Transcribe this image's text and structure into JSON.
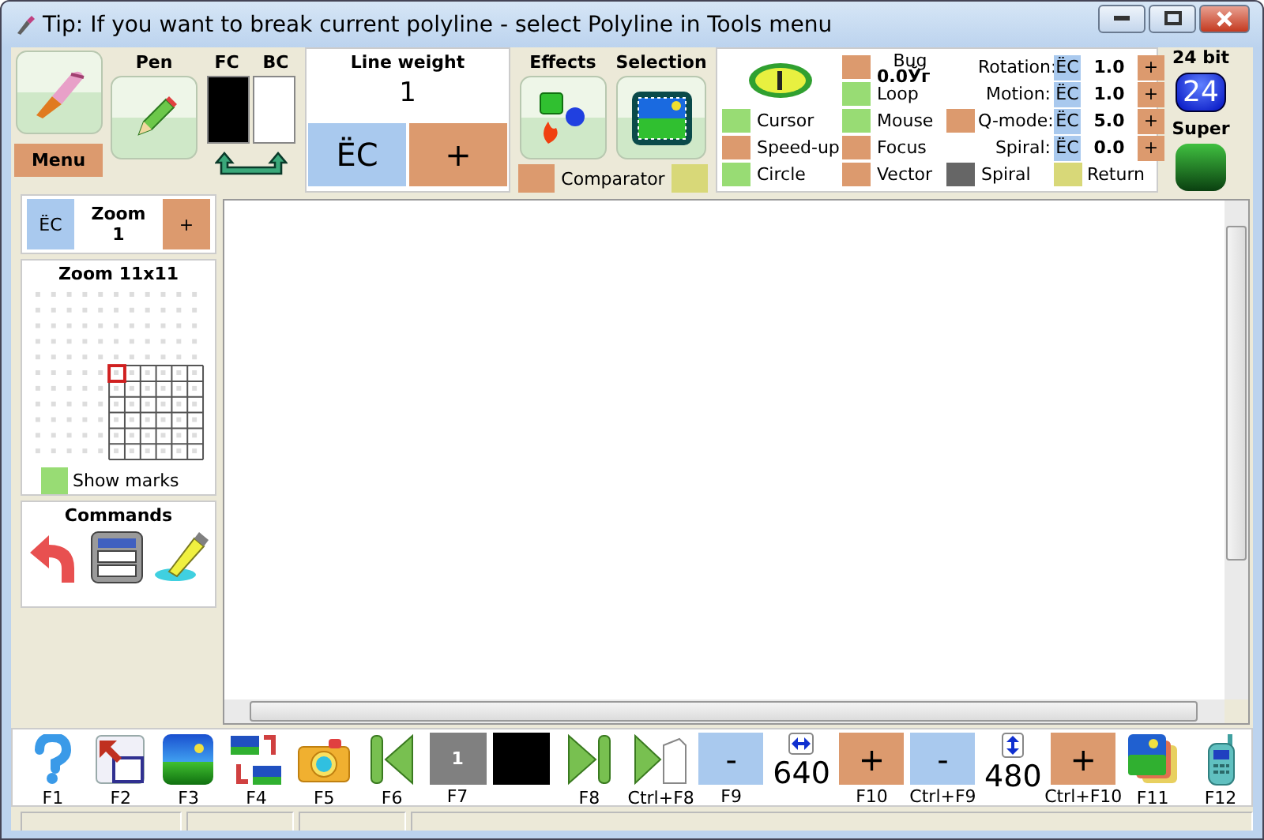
{
  "window": {
    "title": "Tip: If you want to break current polyline - select Polyline in Tools menu"
  },
  "toolbar": {
    "menu": {
      "label": "Menu"
    },
    "pen": {
      "label": "Pen"
    },
    "colors": [
      {
        "label": "FC",
        "color": "#000000"
      },
      {
        "label": "BC",
        "color": "#ffffff"
      }
    ],
    "line_weight": {
      "title": "Line weight",
      "value": "1",
      "minus": "ËC",
      "plus": "+"
    },
    "effects": {
      "label": "Effects"
    },
    "selection": {
      "label": "Selection"
    },
    "comparator": [
      {
        "label": "Comparator",
        "color": "#dc9a6e"
      },
      {
        "color": "#d8d878"
      }
    ]
  },
  "options": {
    "toggles": [
      {
        "label": "Bug",
        "value": "0.0Ўг",
        "color": "#dc9a6e"
      },
      {
        "label": "Loop",
        "color": "#98dc74"
      },
      {
        "label": "Cursor",
        "color": "#98dc74"
      },
      {
        "label": "Mouse",
        "color": "#98dc74"
      },
      {
        "color": "#dc9a6e"
      },
      {
        "label": "Speed-up",
        "color": "#dc9a6e"
      },
      {
        "label": "Focus",
        "color": "#dc9a6e"
      },
      {
        "label": "Circle",
        "color": "#98dc74"
      },
      {
        "label": "Vector",
        "color": "#dc9a6e"
      },
      {
        "label": "Spiral",
        "color": "#666666"
      },
      {
        "label": "Return",
        "color": "#d8d878"
      }
    ],
    "params": [
      {
        "label": "Rotation:",
        "minus": "ËC",
        "value": "1.0",
        "plus": "+"
      },
      {
        "label": "Motion:",
        "minus": "ËC",
        "value": "1.0",
        "plus": "+"
      },
      {
        "label": "Q-mode:",
        "minus": "ËC",
        "value": "5.0",
        "plus": "+"
      },
      {
        "label": "Spiral:",
        "minus": "ËC",
        "value": "0.0",
        "plus": "+"
      }
    ]
  },
  "depth": {
    "label": "24 bit",
    "badge": "24",
    "mode": "Super"
  },
  "zoom": {
    "minus": "ËC",
    "title": "Zoom",
    "value": "1",
    "plus": "+"
  },
  "zoom_view": {
    "title": "Zoom 11x11",
    "show_marks": {
      "label": "Show marks",
      "color": "#98dc74"
    }
  },
  "commands": {
    "title": "Commands"
  },
  "key_bar": [
    {
      "kind": "icon",
      "key": "F1"
    },
    {
      "kind": "icon",
      "key": "F2"
    },
    {
      "kind": "icon",
      "key": "F3"
    },
    {
      "kind": "icon",
      "key": "F4"
    },
    {
      "kind": "icon",
      "key": "F5"
    },
    {
      "kind": "icon",
      "key": "F6"
    },
    {
      "kind": "swatch",
      "text": "1",
      "color": "#808080",
      "key": "F7"
    },
    {
      "kind": "swatch",
      "color": "#000000"
    },
    {
      "kind": "icon",
      "key": "F8"
    },
    {
      "kind": "icon",
      "key": "Ctrl+F8"
    },
    {
      "kind": "button",
      "text": "-",
      "color": "#a9c9ee",
      "key": "F9"
    },
    {
      "kind": "width",
      "text": "640"
    },
    {
      "kind": "button",
      "text": "+",
      "color": "#dc9a6e",
      "key": "F10"
    },
    {
      "kind": "button",
      "text": "-",
      "color": "#a9c9ee",
      "key": "Ctrl+F9"
    },
    {
      "kind": "height",
      "text": "480"
    },
    {
      "kind": "button",
      "text": "+",
      "color": "#dc9a6e",
      "key": "Ctrl+F10"
    },
    {
      "kind": "icon",
      "key": "F11"
    },
    {
      "kind": "icon",
      "key": "F12"
    }
  ]
}
